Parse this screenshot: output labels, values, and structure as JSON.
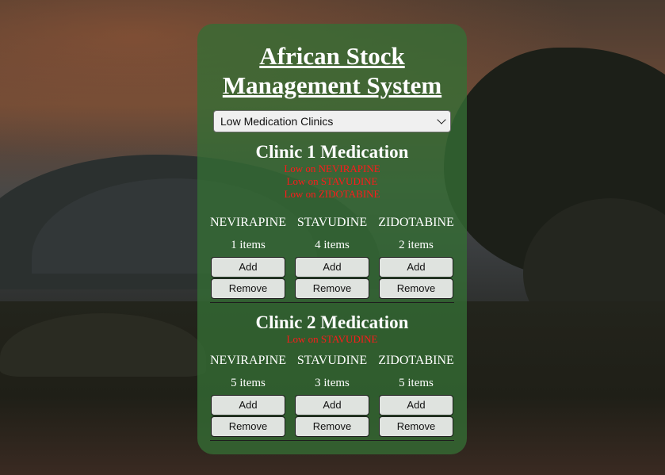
{
  "app": {
    "title": "African Stock Management System"
  },
  "view_select": {
    "selected": "Low Medication Clinics"
  },
  "colors": {
    "panel": "#346e34",
    "alert": "#ff1a1a",
    "button_bg": "#dfe3df"
  },
  "clinics": [
    {
      "title": "Clinic 1 Medication",
      "alerts": [
        "Low on NEVIRAPINE",
        "Low on STAVUDINE",
        "Low on ZIDOTABINE"
      ],
      "medications": [
        {
          "name": "NEVIRAPINE",
          "count": "1 items",
          "add": "Add",
          "remove": "Remove"
        },
        {
          "name": "STAVUDINE",
          "count": "4 items",
          "add": "Add",
          "remove": "Remove"
        },
        {
          "name": "ZIDOTABINE",
          "count": "2 items",
          "add": "Add",
          "remove": "Remove"
        }
      ]
    },
    {
      "title": "Clinic 2 Medication",
      "alerts": [
        "Low on STAVUDINE"
      ],
      "medications": [
        {
          "name": "NEVIRAPINE",
          "count": "5 items",
          "add": "Add",
          "remove": "Remove"
        },
        {
          "name": "STAVUDINE",
          "count": "3 items",
          "add": "Add",
          "remove": "Remove"
        },
        {
          "name": "ZIDOTABINE",
          "count": "5 items",
          "add": "Add",
          "remove": "Remove"
        }
      ]
    }
  ]
}
